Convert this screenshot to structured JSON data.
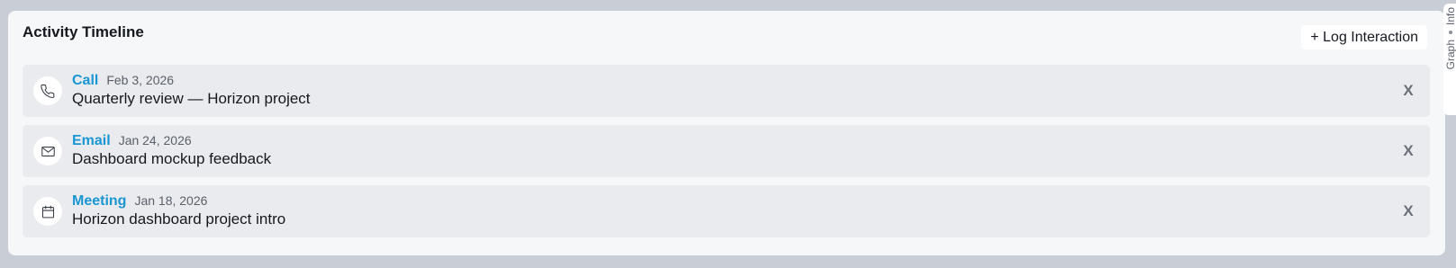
{
  "panel": {
    "title": "Activity Timeline",
    "log_button_label": "+ Log Interaction"
  },
  "entries": [
    {
      "type": "Call",
      "date": "Feb 3, 2026",
      "title": "Quarterly review — Horizon project",
      "icon": "phone-icon",
      "delete_label": "X"
    },
    {
      "type": "Email",
      "date": "Jan 24, 2026",
      "title": "Dashboard mockup feedback",
      "icon": "mail-icon",
      "delete_label": "X"
    },
    {
      "type": "Meeting",
      "date": "Jan 18, 2026",
      "title": "Horizon dashboard project intro",
      "icon": "calendar-icon",
      "delete_label": "X"
    }
  ],
  "side_tabs": {
    "info_label": "Info",
    "graph_label": "Graph"
  },
  "colors": {
    "accent": "#1a96d4",
    "background": "#c9cdd6",
    "panel": "#f6f7f9",
    "entry": "#eaebee"
  }
}
